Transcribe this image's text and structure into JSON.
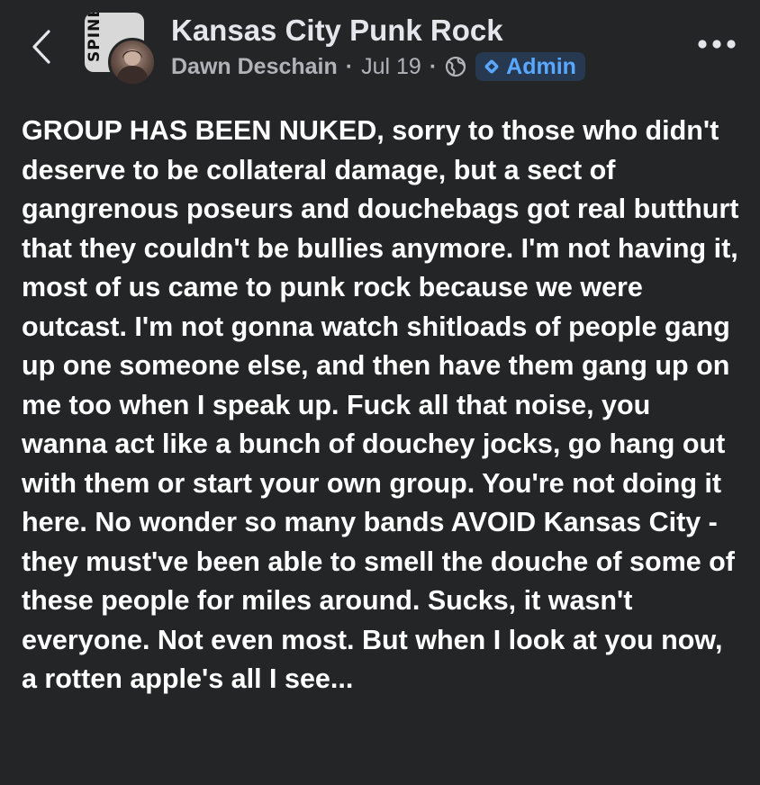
{
  "header": {
    "group_name": "Kansas City Punk Rock",
    "author": "Dawn Deschain",
    "separator": "·",
    "date": "Jul 19",
    "audience_icon": "globe-icon",
    "badge": {
      "label": "Admin",
      "icon": "diamond-icon"
    },
    "back_icon": "chevron-left-icon",
    "more_icon": "more-horizontal-icon",
    "avatar_logo_text": "SPINE"
  },
  "post": {
    "text": "GROUP HAS BEEN NUKED, sorry to those who didn't deserve to be collateral damage, but a sect of gangrenous poseurs and douchebags got real butthurt that they couldn't be bullies anymore. I'm not having it, most of us came to punk rock because we were outcast. I'm not gonna watch shitloads of people gang up one someone else, and then have them gang up on me too when I speak up. Fuck all that noise, you wanna act like a bunch of douchey jocks, go hang out with them or start your own group. You're not doing it here. No wonder so many bands AVOID Kansas City - they must've been able to smell the douche of some of these people for miles around. Sucks, it wasn't everyone. Not even most. But when I look at you now, a rotten apple's all I see..."
  },
  "colors": {
    "background": "#242526",
    "primary_text": "#ffffff",
    "secondary_text": "#b0b3b8",
    "badge_background": "#263951",
    "badge_text": "#5aa7ff"
  }
}
